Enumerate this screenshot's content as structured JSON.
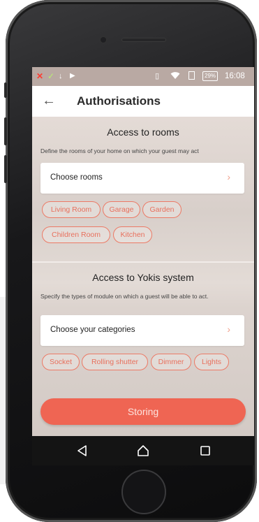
{
  "status_bar": {
    "left_icons": [
      "close-x-icon",
      "check-icon",
      "download-icon",
      "play-store-icon"
    ],
    "right_icons": [
      "vibrate-icon",
      "wifi-icon",
      "sim-icon"
    ],
    "battery": "29%",
    "time": "16:08"
  },
  "app_bar": {
    "back_icon": "arrow-left-icon",
    "title": "Authorisations"
  },
  "rooms_section": {
    "title": "Access to rooms",
    "description": "Define the rooms of your home on which your guest may act",
    "selector_label": "Choose rooms",
    "chips": [
      "Living Room",
      "Garage",
      "Garden",
      "Children Room",
      "Kitchen"
    ]
  },
  "system_section": {
    "title": "Access to Yokis system",
    "description": "Specify the types of module on which a guest will be able to act.",
    "selector_label": "Choose your categories",
    "chips": [
      "Socket",
      "Rolling shutter",
      "Dimmer",
      "Lights"
    ]
  },
  "primary_button": {
    "label": "Storing"
  },
  "nav_bar": {
    "icons": [
      "back-triangle-icon",
      "home-icon",
      "recents-icon"
    ]
  },
  "colors": {
    "accent": "#ef6553",
    "chip_border": "#ec7a66",
    "status_bar": "#b9a9a3",
    "nav_bar": "#141414"
  }
}
